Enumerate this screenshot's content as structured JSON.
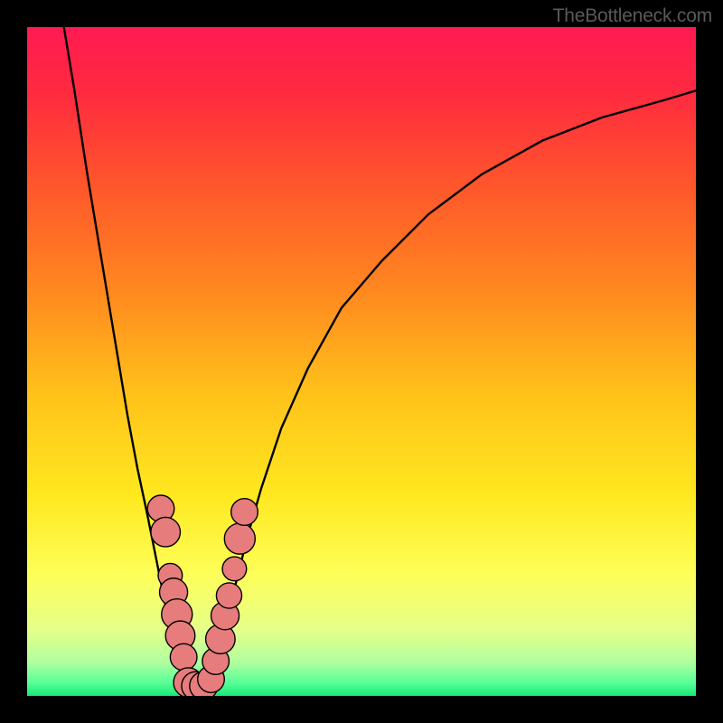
{
  "watermark": "TheBottleneck.com",
  "gradient": {
    "stops": [
      {
        "offset": 0.0,
        "color": "#ff1a52"
      },
      {
        "offset": 0.1,
        "color": "#ff2b3f"
      },
      {
        "offset": 0.25,
        "color": "#ff5a2a"
      },
      {
        "offset": 0.4,
        "color": "#ff8a1f"
      },
      {
        "offset": 0.55,
        "color": "#ffc21a"
      },
      {
        "offset": 0.7,
        "color": "#ffe81f"
      },
      {
        "offset": 0.82,
        "color": "#fdff5a"
      },
      {
        "offset": 0.9,
        "color": "#e6ff88"
      },
      {
        "offset": 0.95,
        "color": "#b0ffa0"
      },
      {
        "offset": 0.98,
        "color": "#59ff98"
      },
      {
        "offset": 1.0,
        "color": "#18e877"
      }
    ]
  },
  "chart_data": {
    "type": "line",
    "title": "",
    "xlabel": "",
    "ylabel": "",
    "xlim": [
      0,
      100
    ],
    "ylim": [
      0,
      100
    ],
    "series": [
      {
        "name": "left-curve",
        "x": [
          5.5,
          7,
          9,
          11,
          13,
          15,
          16.5,
          18,
          19,
          20,
          21,
          22,
          23,
          24
        ],
        "y": [
          100,
          91,
          78,
          66,
          54,
          42,
          34,
          27,
          22,
          17,
          12,
          8,
          4,
          0.5
        ]
      },
      {
        "name": "right-curve",
        "x": [
          27,
          28,
          29,
          30,
          31.5,
          33,
          35,
          38,
          42,
          47,
          53,
          60,
          68,
          77,
          86,
          95,
          100
        ],
        "y": [
          0.5,
          4,
          8,
          12,
          18,
          24,
          31,
          40,
          49,
          58,
          65,
          72,
          78,
          83,
          86.5,
          89,
          90.5
        ]
      }
    ],
    "markers": [
      {
        "series": "left-curve",
        "x": 20.0,
        "y": 28.0,
        "r": 2.0
      },
      {
        "series": "left-curve",
        "x": 20.7,
        "y": 24.5,
        "r": 2.2
      },
      {
        "series": "left-curve",
        "x": 21.4,
        "y": 18.0,
        "r": 1.8
      },
      {
        "series": "left-curve",
        "x": 21.9,
        "y": 15.5,
        "r": 2.1
      },
      {
        "series": "left-curve",
        "x": 22.4,
        "y": 12.2,
        "r": 2.3
      },
      {
        "series": "left-curve",
        "x": 22.9,
        "y": 9.0,
        "r": 2.2
      },
      {
        "series": "left-curve",
        "x": 23.4,
        "y": 5.8,
        "r": 2.0
      },
      {
        "series": "left-curve",
        "x": 24.1,
        "y": 2.0,
        "r": 2.2
      },
      {
        "series": "center",
        "x": 25.2,
        "y": 1.5,
        "r": 2.1
      },
      {
        "series": "center",
        "x": 26.4,
        "y": 1.5,
        "r": 2.1
      },
      {
        "series": "right-curve",
        "x": 27.5,
        "y": 2.5,
        "r": 2.0
      },
      {
        "series": "right-curve",
        "x": 28.2,
        "y": 5.2,
        "r": 2.0
      },
      {
        "series": "right-curve",
        "x": 28.9,
        "y": 8.5,
        "r": 2.2
      },
      {
        "series": "right-curve",
        "x": 29.6,
        "y": 12.0,
        "r": 2.1
      },
      {
        "series": "right-curve",
        "x": 30.2,
        "y": 15.0,
        "r": 1.9
      },
      {
        "series": "right-curve",
        "x": 31.0,
        "y": 19.0,
        "r": 1.8
      },
      {
        "series": "right-curve",
        "x": 31.8,
        "y": 23.5,
        "r": 2.3
      },
      {
        "series": "right-curve",
        "x": 32.5,
        "y": 27.5,
        "r": 2.0
      }
    ],
    "marker_color": "#e77c7c",
    "marker_stroke": "#000000",
    "line_color": "#000000",
    "line_width": 2.4
  }
}
